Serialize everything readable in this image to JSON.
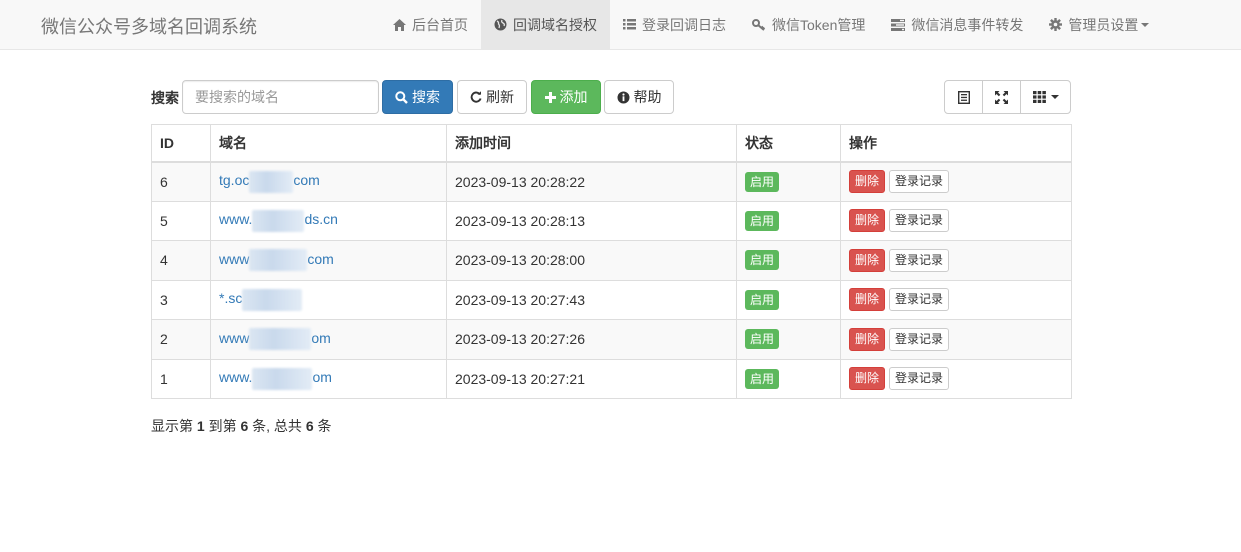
{
  "brand": "微信公众号多域名回调系统",
  "nav": [
    {
      "label": "后台首页",
      "icon": "home-icon",
      "active": false
    },
    {
      "label": "回调域名授权",
      "icon": "globe-icon",
      "active": true
    },
    {
      "label": "登录回调日志",
      "icon": "list-icon",
      "active": false
    },
    {
      "label": "微信Token管理",
      "icon": "key-icon",
      "active": false
    },
    {
      "label": "微信消息事件转发",
      "icon": "tasks-icon",
      "active": false
    },
    {
      "label": "管理员设置",
      "icon": "gear-icon",
      "active": false
    }
  ],
  "toolbar": {
    "search_label": "搜索",
    "search_placeholder": "要搜索的域名",
    "search_button": "搜索",
    "refresh_button": "刷新",
    "add_button": "添加",
    "help_button": "帮助"
  },
  "table": {
    "headers": [
      "ID",
      "域名",
      "添加时间",
      "状态",
      "操作"
    ],
    "rows": [
      {
        "id": "6",
        "domain_prefix": "tg.oc",
        "domain_suffix": "com",
        "time": "2023-09-13 20:28:22",
        "status": "启用"
      },
      {
        "id": "5",
        "domain_prefix": "www.",
        "domain_suffix": "ds.cn",
        "time": "2023-09-13 20:28:13",
        "status": "启用"
      },
      {
        "id": "4",
        "domain_prefix": "www",
        "domain_suffix": "com",
        "time": "2023-09-13 20:28:00",
        "status": "启用"
      },
      {
        "id": "3",
        "domain_prefix": "*.sc",
        "domain_suffix": "",
        "time": "2023-09-13 20:27:43",
        "status": "启用"
      },
      {
        "id": "2",
        "domain_prefix": "www",
        "domain_suffix": "om",
        "time": "2023-09-13 20:27:26",
        "status": "启用"
      },
      {
        "id": "1",
        "domain_prefix": "www.",
        "domain_suffix": "om",
        "time": "2023-09-13 20:27:21",
        "status": "启用"
      }
    ],
    "delete_label": "删除",
    "log_label": "登录记录"
  },
  "pagination": {
    "prefix": "显示第",
    "from": "1",
    "to_word": "到第",
    "to": "6",
    "mid": "条, 总共",
    "total": "6",
    "suffix": "条"
  },
  "colors": {
    "primary": "#337ab7",
    "success": "#5cb85c",
    "danger": "#d9534f"
  }
}
